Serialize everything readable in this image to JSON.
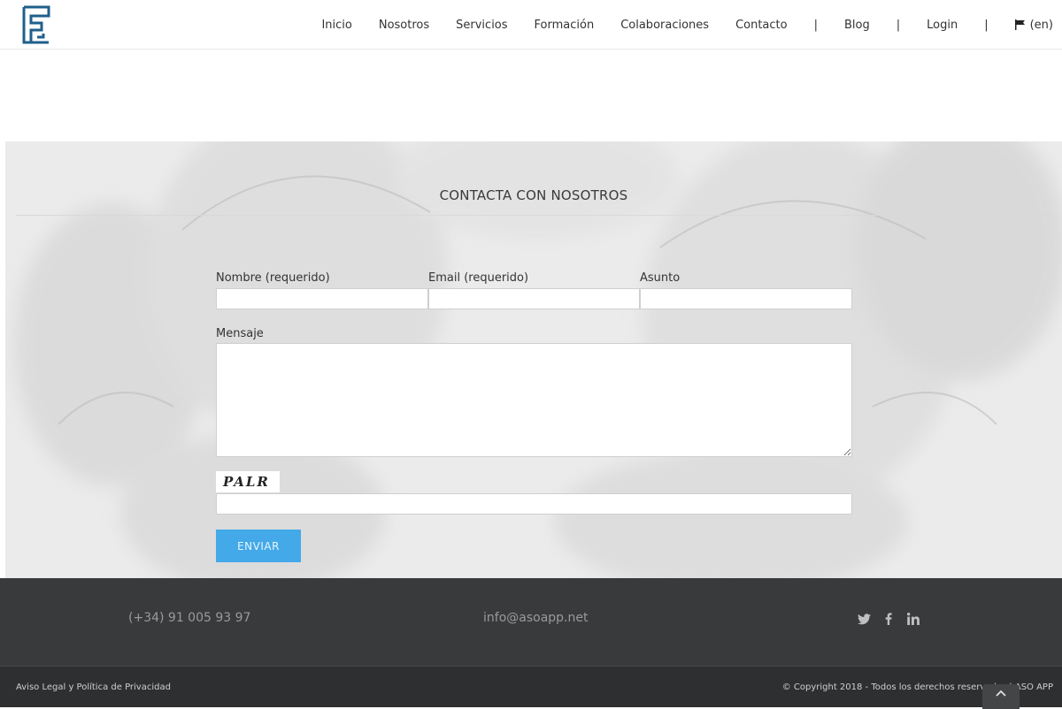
{
  "header": {
    "logo_icon": "asoapp-logo-icon",
    "nav": {
      "inicio": "Inicio",
      "nosotros": "Nosotros",
      "servicios": "Servicios",
      "formacion": "Formación",
      "colaboraciones": "Colaboraciones",
      "contacto": "Contacto",
      "separator": "|",
      "blog": "Blog",
      "login": "Login",
      "lang": "(en)",
      "lang_icon": "flag-icon"
    }
  },
  "contact": {
    "title": "CONTACTA CON NOSOTROS",
    "fields": {
      "name_label": "Nombre (requerido)",
      "email_label": "Email (requerido)",
      "subject_label": "Asunto",
      "message_label": "Mensaje"
    },
    "captcha_text": "PALR",
    "submit_label": "ENVIAR"
  },
  "footer": {
    "phone": "(+34) 91 005 93 97",
    "email": "info@asoapp.net",
    "social_icons": [
      "twitter-icon",
      "facebook-icon",
      "linkedin-icon"
    ]
  },
  "bottom": {
    "legal": "Aviso Legal y Política de Privacidad",
    "copyright": "© Copyright 2018 - Todos los derechos reservados | ASO APP",
    "totop_icon": "chevron-up-icon"
  },
  "colors": {
    "accent": "#43a9e8",
    "logo": "#1f5f8b",
    "footer_bg": "#393a3c",
    "copyright_bg": "#2e2f31"
  }
}
